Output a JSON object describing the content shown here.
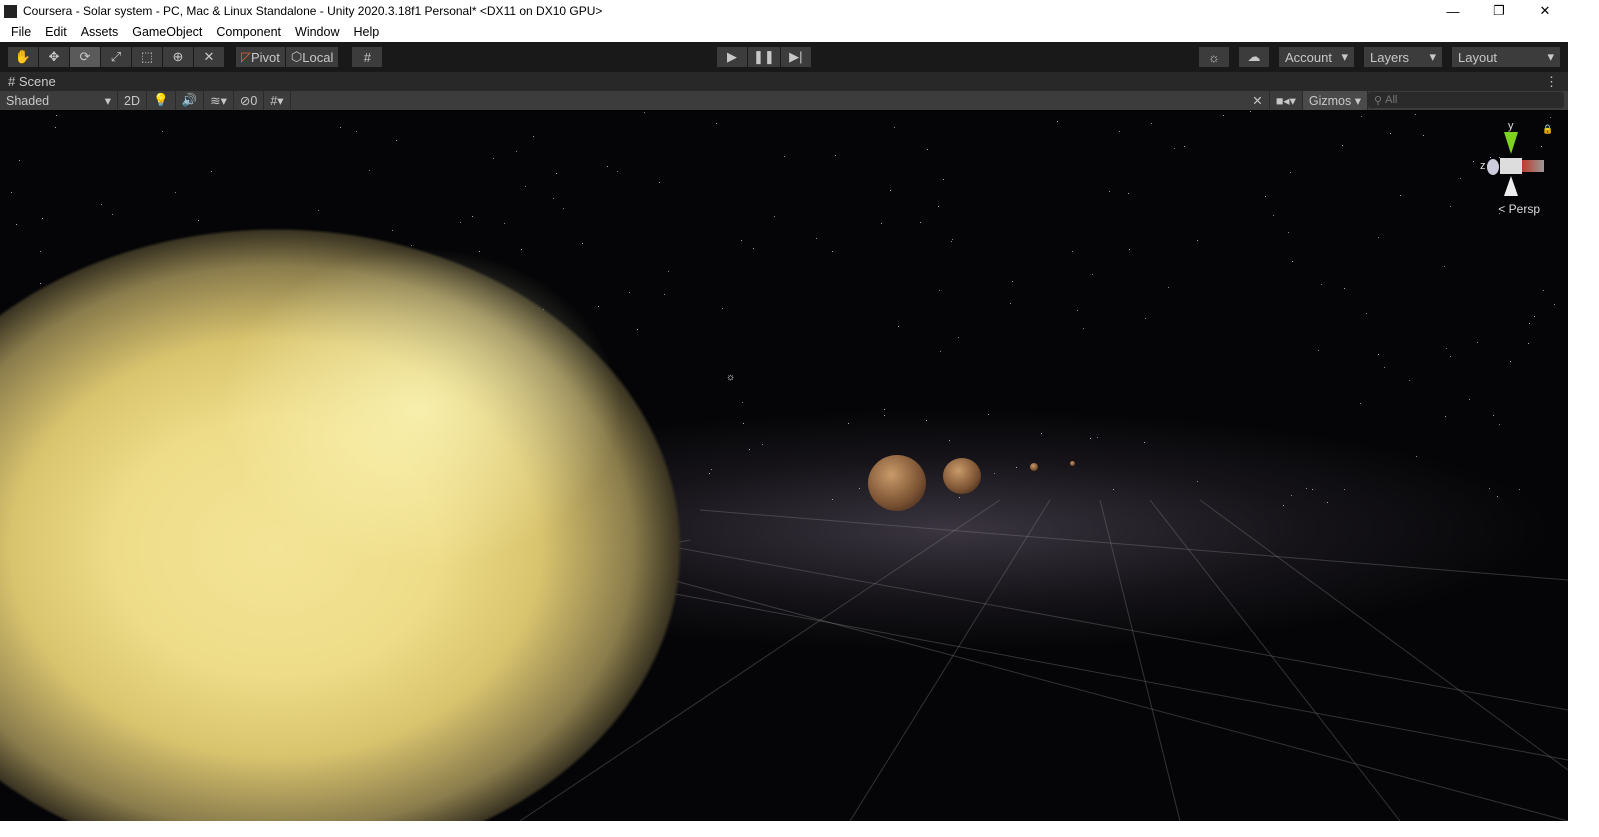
{
  "window": {
    "title": "Coursera - Solar system - PC, Mac & Linux Standalone - Unity 2020.3.18f1 Personal* <DX11 on DX10 GPU>",
    "minimize": "—",
    "maximize": "❐",
    "close": "✕"
  },
  "menu": [
    "File",
    "Edit",
    "Assets",
    "GameObject",
    "Component",
    "Window",
    "Help"
  ],
  "toolbar": {
    "tools": [
      "hand-tool",
      "move-tool",
      "rotate-tool",
      "scale-tool",
      "rect-tool",
      "transform-tool",
      "custom-tool"
    ],
    "active_tool": "rotate-tool",
    "pivot": "Pivot",
    "local": "Local",
    "account": "Account",
    "layers": "Layers",
    "layout": "Layout"
  },
  "scene_tab": {
    "label": "Scene"
  },
  "scene_bar": {
    "draw_mode": "Shaded",
    "mode_2d": "2D",
    "hidden_count": "0",
    "gizmos": "Gizmos",
    "search_placeholder": "All"
  },
  "view": {
    "projection": "Persp",
    "axis_y": "y",
    "axis_z": "z"
  }
}
